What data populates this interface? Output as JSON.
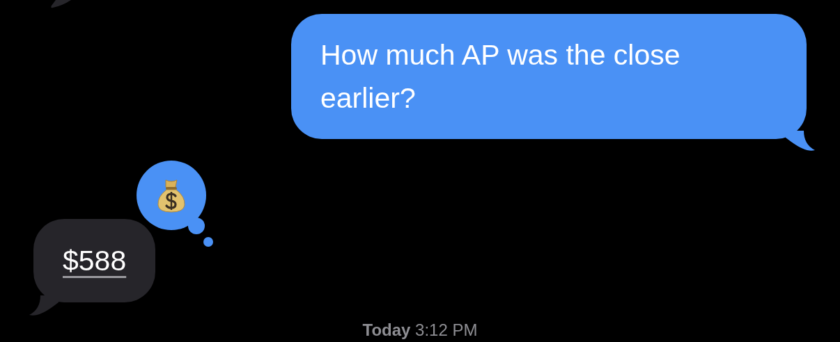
{
  "messages": [
    {
      "kind": "outgoing",
      "text": "How much AP was the close earlier?"
    },
    {
      "kind": "incoming",
      "link": "$588",
      "tapback": true
    }
  ],
  "timestamp": {
    "day": "Today",
    "time": "3:12 PM"
  }
}
